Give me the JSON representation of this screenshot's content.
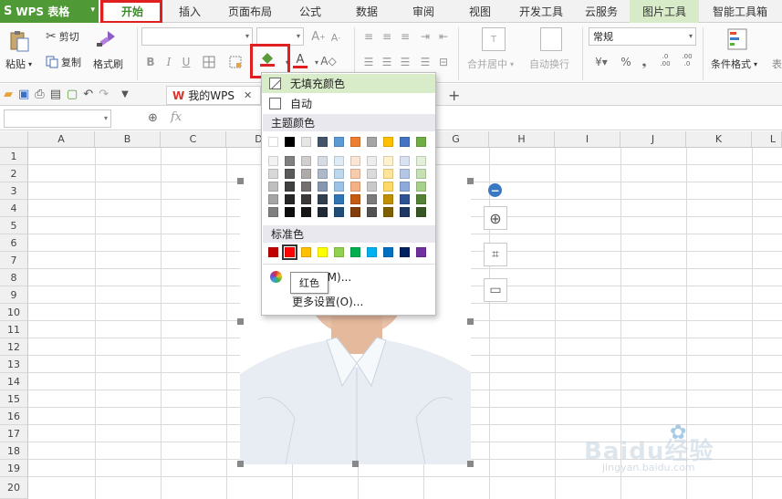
{
  "app": {
    "name": "WPS 表格"
  },
  "ribbon_tabs": [
    {
      "label": "开始",
      "active": true
    },
    {
      "label": "插入"
    },
    {
      "label": "页面布局"
    },
    {
      "label": "公式"
    },
    {
      "label": "数据"
    },
    {
      "label": "审阅"
    },
    {
      "label": "视图"
    },
    {
      "label": "开发工具"
    },
    {
      "label": "云服务"
    },
    {
      "label": "图片工具"
    },
    {
      "label": "智能工具箱"
    }
  ],
  "ribbon": {
    "paste": "粘贴",
    "cut": "剪切",
    "copy": "复制",
    "format_painter": "格式刷",
    "bold": "B",
    "italic": "I",
    "underline": "U",
    "font_grow": "A",
    "font_shrink": "A",
    "merge_center": "合并居中",
    "wrap_text": "自动换行",
    "number_format": "常规",
    "percent": "%",
    "comma": "❟",
    "inc_decimal": ".0 .00",
    "dec_decimal": ".00 .0",
    "conditional_format": "条件格式",
    "cut_off": "表"
  },
  "qat": {
    "doc_tab": "我的WPS",
    "close": "✕",
    "add": "+"
  },
  "formula_bar": {
    "fx": "fx"
  },
  "columns": [
    "A",
    "B",
    "C",
    "D",
    "E",
    "F",
    "G",
    "H",
    "I",
    "J",
    "K",
    "L"
  ],
  "rows": [
    "1",
    "2",
    "3",
    "4",
    "5",
    "6",
    "7",
    "8",
    "9",
    "10",
    "11",
    "12",
    "13",
    "14",
    "15",
    "16",
    "17",
    "18",
    "19",
    "20"
  ],
  "fill_menu": {
    "no_fill": "无填充颜色",
    "auto": "自动",
    "theme_colors": "主题颜色",
    "standard_colors": "标准色",
    "more_colors": "色(M)...",
    "more_settings": "更多设置(O)...",
    "tooltip": "红色"
  },
  "colors": {
    "wps_green": "#4f9a36",
    "highlight_red": "#e02020",
    "theme_top": [
      "#ffffff",
      "#000000",
      "#e7e6e6",
      "#44546a",
      "#5b9bd5",
      "#ed7d31",
      "#a5a5a5",
      "#ffc000",
      "#4472c4",
      "#70ad47"
    ],
    "theme_tints": [
      [
        "#f2f2f2",
        "#808080",
        "#d0cece",
        "#d6dce4",
        "#deebf6",
        "#fbe5d5",
        "#ededed",
        "#fff2cc",
        "#d9e2f3",
        "#e2efd9"
      ],
      [
        "#d8d8d8",
        "#595959",
        "#aeaaaa",
        "#adb9ca",
        "#bdd7ee",
        "#f7cbac",
        "#dbdbdb",
        "#fee599",
        "#b4c6e7",
        "#c5e0b3"
      ],
      [
        "#bfbfbf",
        "#404040",
        "#757070",
        "#8496b0",
        "#9cc3e5",
        "#f4b183",
        "#c9c9c9",
        "#ffd965",
        "#8eaadb",
        "#a8d08d"
      ],
      [
        "#a5a5a5",
        "#262626",
        "#3a3838",
        "#323f4f",
        "#2e75b5",
        "#c55a11",
        "#7b7b7b",
        "#bf9000",
        "#2f5496",
        "#538135"
      ],
      [
        "#7f7f7f",
        "#0d0d0d",
        "#171616",
        "#222a35",
        "#1e4e79",
        "#833c0b",
        "#525252",
        "#7f6000",
        "#1f3864",
        "#375623"
      ]
    ],
    "standard": [
      "#c00000",
      "#ff0000",
      "#ffc000",
      "#ffff00",
      "#92d050",
      "#00b050",
      "#00b0f0",
      "#0070c0",
      "#002060",
      "#7030a0"
    ]
  },
  "watermark": {
    "brand": "Baidu经验",
    "url": "jingyan.baidu.com"
  }
}
